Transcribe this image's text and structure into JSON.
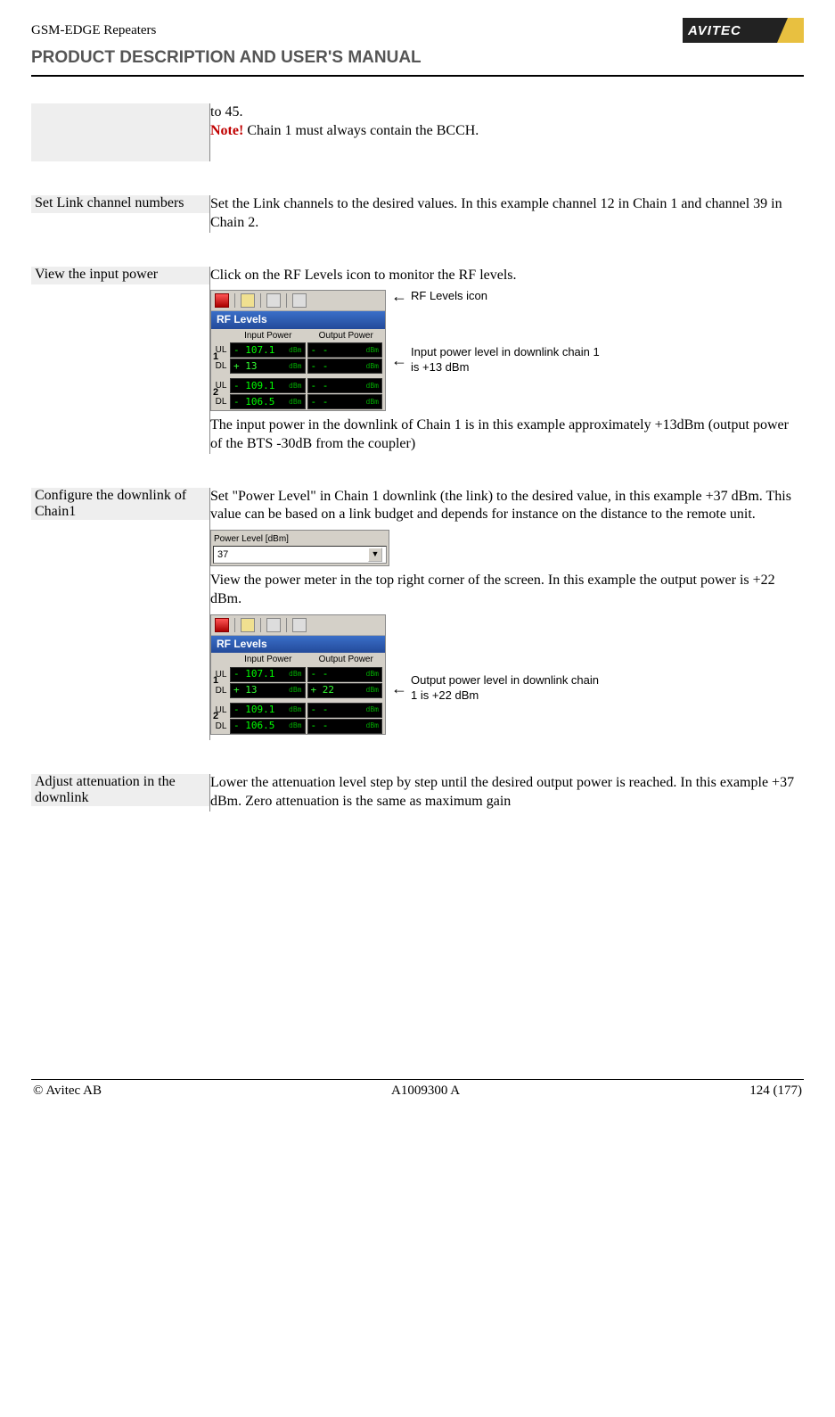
{
  "header": {
    "product_line": "GSM-EDGE Repeaters",
    "subheader": "PRODUCT DESCRIPTION AND USER'S MANUAL",
    "logo_text": "AVITEC"
  },
  "sections": {
    "intro": {
      "line1": "to 45.",
      "note_label": "Note!",
      "note_text": " Chain 1 must always contain the BCCH."
    },
    "set_link": {
      "label": "Set Link channel numbers",
      "body": "Set the Link channels to the desired values. In this example channel 12 in Chain 1 and channel 39 in Chain 2."
    },
    "view_input": {
      "label": "View the input power",
      "body_top": "Click on the RF Levels icon to monitor the RF levels.",
      "ann_icon": "RF Levels icon",
      "ann_input": "Input power level in downlink chain 1 is +13 dBm",
      "body_bottom": "The input power in the downlink of Chain 1 is in this example approximately +13dBm (output power of the BTS -30dB from the coupler)"
    },
    "configure": {
      "label": "Configure the downlink of Chain1",
      "body_top": "Set \"Power Level\" in Chain 1 downlink (the link) to the desired value, in this example +37 dBm. This value can be based on a link budget and depends for instance on the distance to the remote unit.",
      "plevel_label": "Power Level [dBm]",
      "plevel_value": "37",
      "body_mid": "View the power meter in the top right corner of the screen. In this example the output power is +22 dBm.",
      "ann_output": "Output power level in downlink chain 1 is +22 dBm"
    },
    "adjust": {
      "label": "Adjust attenuation in the downlink",
      "body": "Lower the attenuation level step by step until the desired output power is reached. In this example +37 dBm. Zero attenuation is the same as maximum gain"
    }
  },
  "rf_panel": {
    "title": "RF Levels",
    "col1": "Input Power",
    "col2": "Output Power",
    "ul": "UL",
    "dl": "DL",
    "one": "1",
    "two": "2",
    "unit": "dBm",
    "v_ul1_in": "- 107.1",
    "v_ul1_out": "- -",
    "v_dl1_in": "+ 13",
    "v_dl1_out_a": "- -",
    "v_dl1_out_b": "+ 22",
    "v_ul2_in": "- 109.1",
    "v_ul2_out": "- -",
    "v_dl2_in": "- 106.5",
    "v_dl2_out": "- -"
  },
  "footer": {
    "left": "© Avitec AB",
    "center": "A1009300 A",
    "right": "124 (177)"
  }
}
